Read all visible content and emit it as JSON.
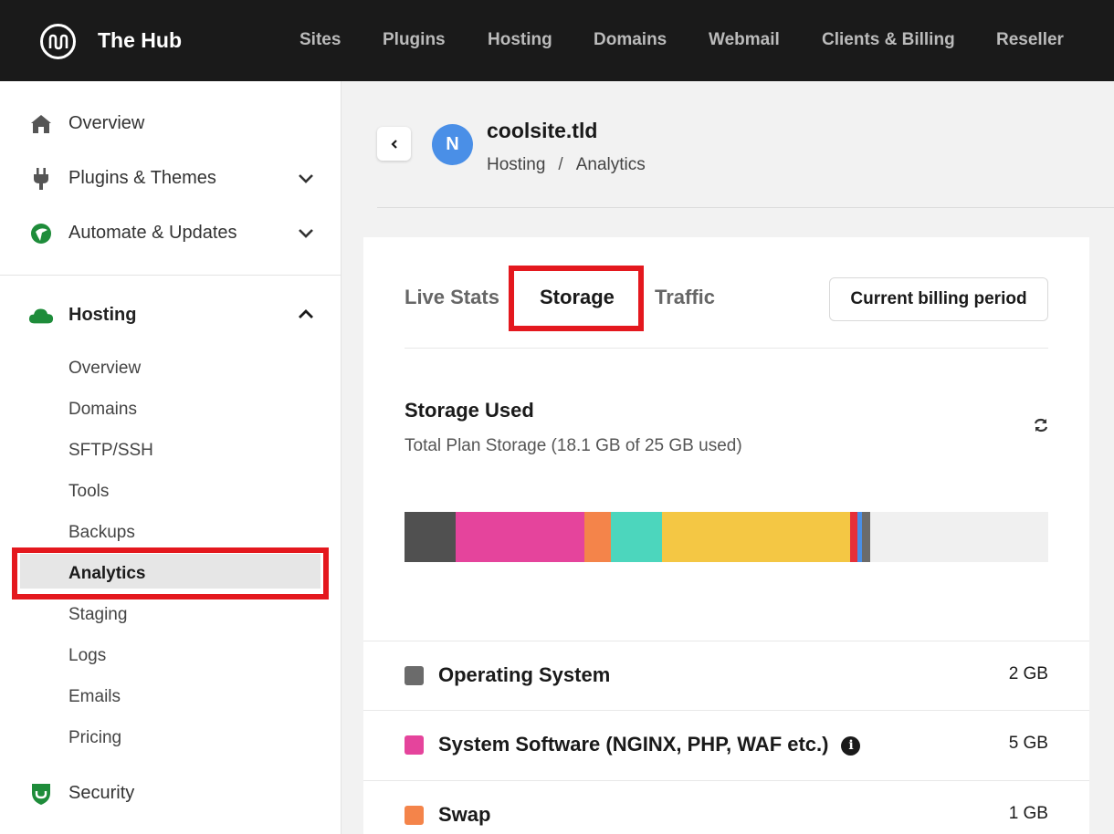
{
  "brand": "The Hub",
  "topnav": [
    "Sites",
    "Plugins",
    "Hosting",
    "Domains",
    "Webmail",
    "Clients & Billing",
    "Reseller"
  ],
  "sidebar": {
    "main": [
      {
        "label": "Overview",
        "icon": "home-icon"
      },
      {
        "label": "Plugins & Themes",
        "icon": "plug-icon"
      },
      {
        "label": "Automate & Updates",
        "icon": "automate-icon"
      }
    ],
    "hosting": {
      "label": "Hosting",
      "icon": "cloud-icon"
    },
    "sub": [
      "Overview",
      "Domains",
      "SFTP/SSH",
      "Tools",
      "Backups",
      "Analytics",
      "Staging",
      "Logs",
      "Emails",
      "Pricing"
    ],
    "security": {
      "label": "Security",
      "icon": "shield-icon"
    }
  },
  "site": {
    "avatar": "N",
    "name": "coolsite.tld",
    "breadcrumb": [
      "Hosting",
      "Analytics"
    ],
    "breadcrumb_sep": "/"
  },
  "tabs": [
    "Live Stats",
    "Storage",
    "Traffic"
  ],
  "active_tab": "Storage",
  "period_label": "Current billing period",
  "storage": {
    "title": "Storage Used",
    "subtitle": "Total Plan Storage (18.1 GB of 25 GB used)",
    "rows": [
      {
        "name": "Operating System",
        "size": "2 GB",
        "color": "#6b6b6b"
      },
      {
        "name": "System Software (NGINX, PHP, WAF etc.)",
        "size": "5 GB",
        "color": "#e5449c",
        "info": true
      },
      {
        "name": "Swap",
        "size": "1 GB",
        "color": "#f4844a"
      }
    ]
  },
  "chart_data": {
    "type": "bar",
    "total_gb": 25,
    "used_gb": 18.1,
    "segments": [
      {
        "color": "#505050",
        "value": 2
      },
      {
        "color": "#e5449c",
        "value": 5
      },
      {
        "color": "#f4844a",
        "value": 1
      },
      {
        "color": "#4cd6bd",
        "value": 2
      },
      {
        "color": "#f4c744",
        "value": 7.3
      },
      {
        "color": "#e6303a",
        "value": 0.3
      },
      {
        "color": "#4a8fe7",
        "value": 0.15
      },
      {
        "color": "#6b6b6b",
        "value": 0.35
      }
    ]
  }
}
